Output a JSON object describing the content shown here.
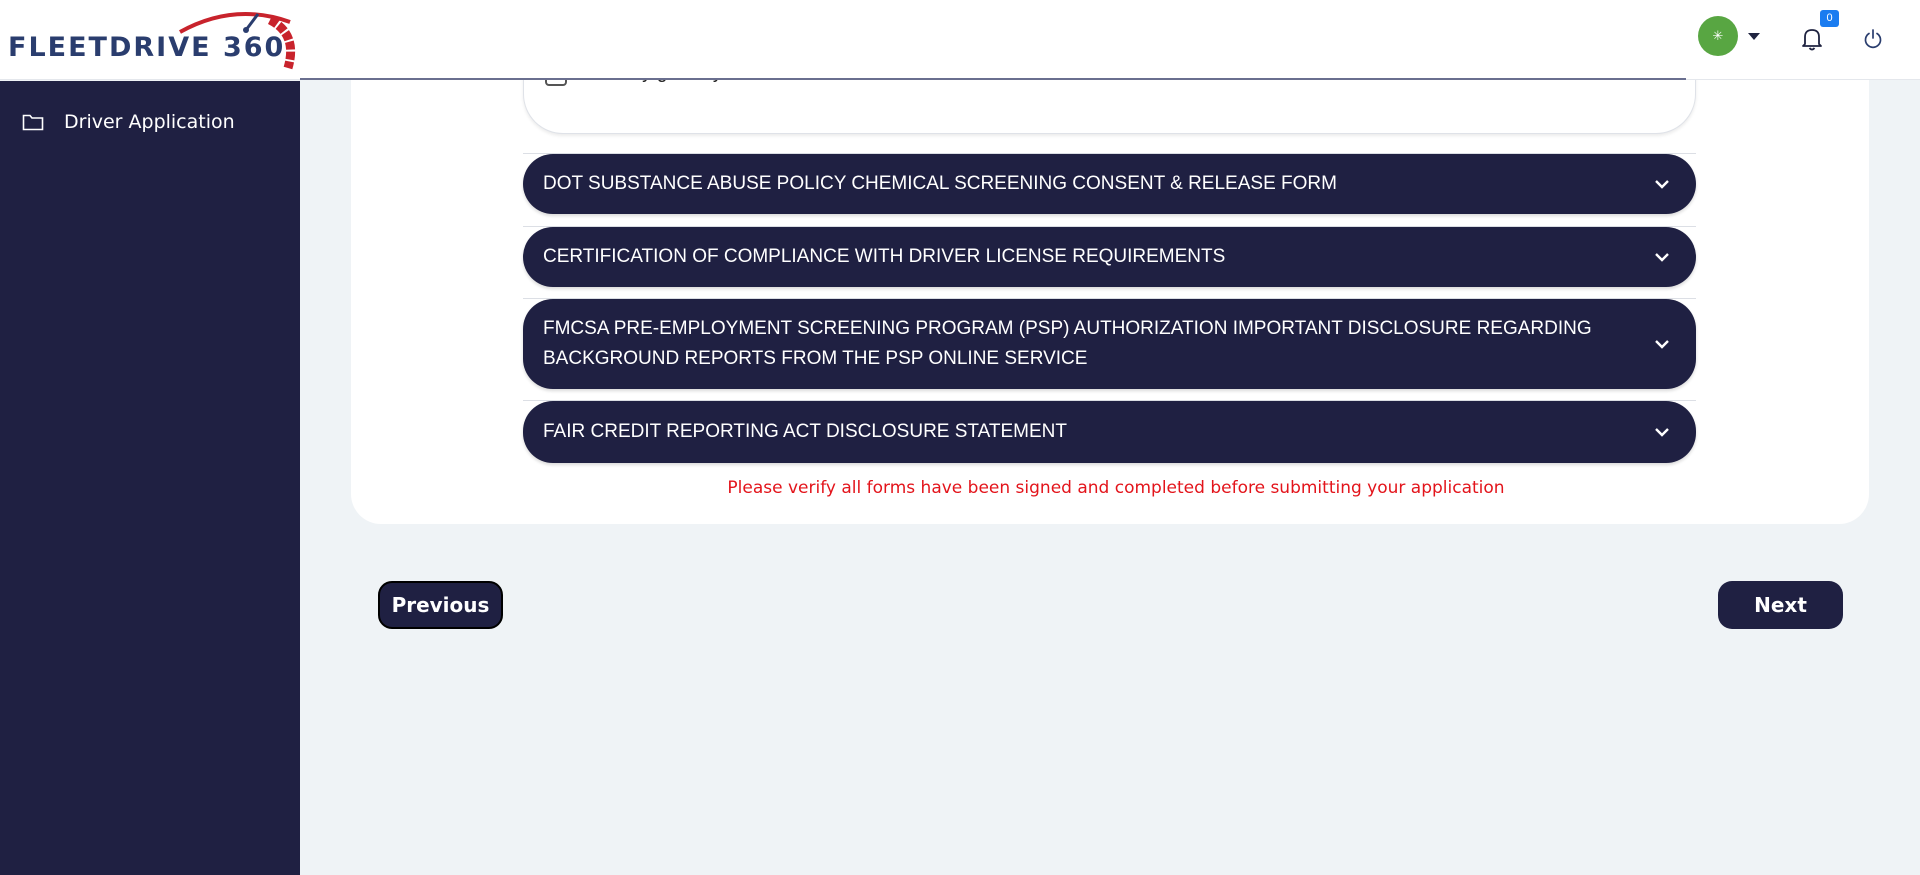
{
  "brand": {
    "logo_text": "FLEETDRIVE 360"
  },
  "header": {
    "notification_count": "0",
    "avatar_glyph": "✳"
  },
  "sidebar": {
    "items": [
      {
        "label": "Driver Application",
        "icon": "folder-icon"
      }
    ]
  },
  "consent": {
    "label": "I hereby give my Consent for the Above."
  },
  "accordions": [
    {
      "title": "DOT SUBSTANCE ABUSE POLICY CHEMICAL SCREENING CONSENT & RELEASE FORM"
    },
    {
      "title": "CERTIFICATION OF COMPLIANCE WITH DRIVER LICENSE REQUIREMENTS"
    },
    {
      "title": "FMCSA PRE-EMPLOYMENT SCREENING PROGRAM (PSP) AUTHORIZATION IMPORTANT DISCLOSURE REGARDING BACKGROUND REPORTS FROM THE PSP ONLINE SERVICE"
    },
    {
      "title": "FAIR CREDIT REPORTING ACT DISCLOSURE STATEMENT"
    }
  ],
  "warning": "Please verify all forms have been signed and completed before submitting your application",
  "nav": {
    "previous_label": "Previous",
    "next_label": "Next"
  },
  "colors": {
    "navy": "#1f2042",
    "warning": "#e3141b",
    "avatar": "#58a642",
    "badge": "#1a7cf0",
    "logo_red": "#c8232c",
    "logo_blue": "#2a3d6e"
  }
}
